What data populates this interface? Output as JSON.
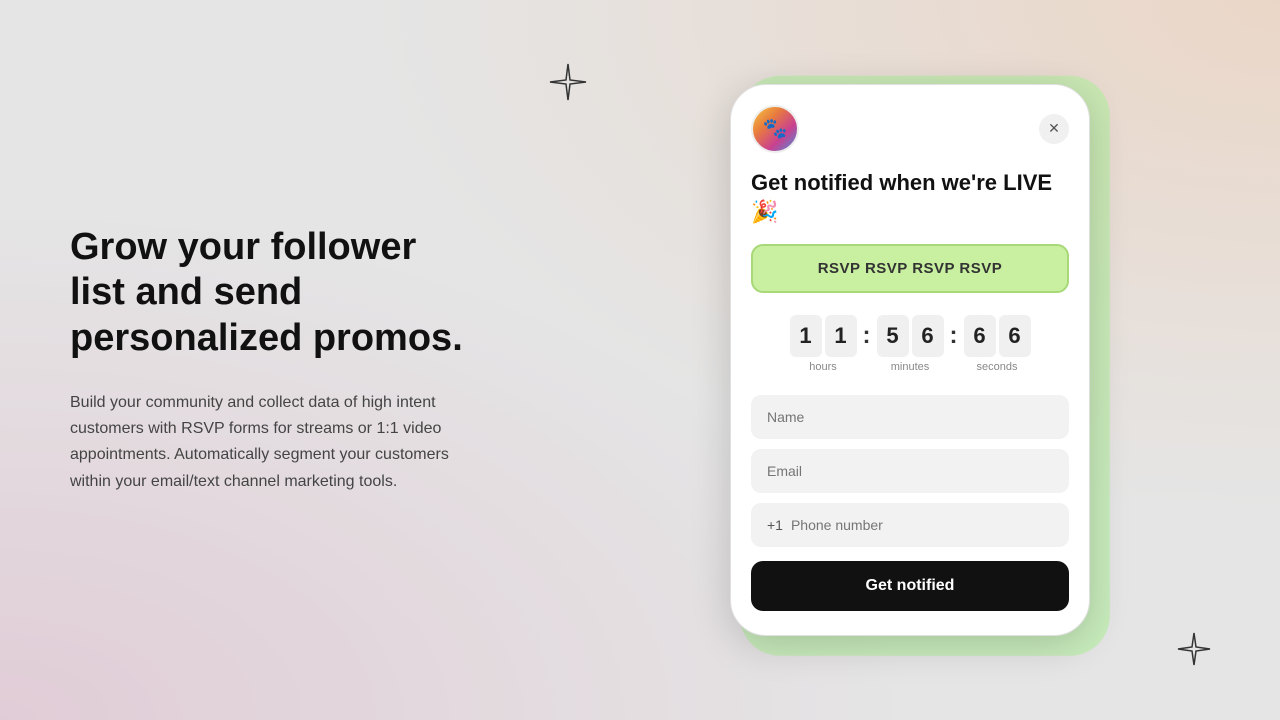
{
  "background": {
    "color": "#e5e5e5"
  },
  "left": {
    "heading": "Grow your follower list and send personalized promos.",
    "body": "Build your community and collect data of high intent customers with RSVP forms for streams or 1:1 video appointments. Automatically segment your customers within your email/text channel marketing tools."
  },
  "decorations": {
    "star_top_symbol": "✦",
    "star_bottom_symbol": "✦"
  },
  "modal": {
    "title": "Get notified when we're LIVE 🎉",
    "rsvp_button": "RSVP RSVP RSVP RSVP",
    "countdown": {
      "hours": [
        "1",
        "1"
      ],
      "minutes": [
        "5",
        "6"
      ],
      "seconds": [
        "6",
        "6"
      ],
      "hours_label": "hours",
      "minutes_label": "minutes",
      "seconds_label": "seconds"
    },
    "name_placeholder": "Name",
    "email_placeholder": "Email",
    "country_code": "+1",
    "phone_placeholder": "Phone number",
    "submit_button": "Get notified"
  }
}
